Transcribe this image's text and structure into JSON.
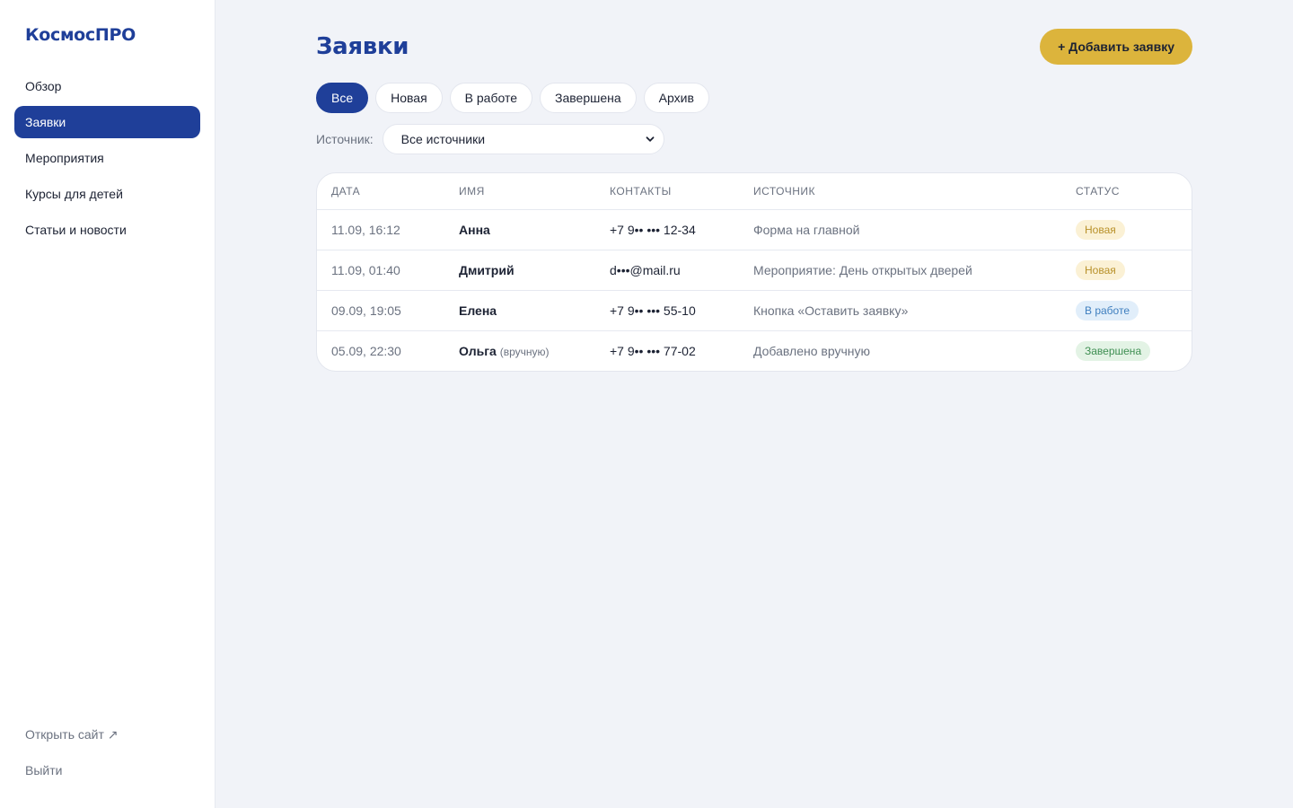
{
  "sidebar": {
    "logo": "КосмосПРО",
    "items": [
      {
        "label": "Обзор"
      },
      {
        "label": "Заявки",
        "active": true
      },
      {
        "label": "Мероприятия"
      },
      {
        "label": "Курсы для детей"
      },
      {
        "label": "Статьи и новости"
      }
    ],
    "open_site": "Открыть сайт ↗",
    "logout": "Выйти"
  },
  "header": {
    "title": "Заявки",
    "add_button": "+ Добавить заявку"
  },
  "filters": {
    "chips": [
      "Все",
      "Новая",
      "В работе",
      "Завершена",
      "Архив"
    ],
    "active": "Все"
  },
  "source_filter": {
    "label": "Источник:",
    "selected": "Все источники"
  },
  "table": {
    "headers": [
      "ДАТА",
      "ИМЯ",
      "КОНТАКТЫ",
      "ИСТОЧНИК",
      "СТАТУС"
    ],
    "rows": [
      {
        "date": "11.09, 16:12",
        "name": "Анна",
        "note": "",
        "contacts": "+7 9•• ••• 12-34",
        "source": "Форма на главной",
        "status": "Новая",
        "status_kind": "new"
      },
      {
        "date": "11.09, 01:40",
        "name": "Дмитрий",
        "note": "",
        "contacts": "d•••@mail.ru",
        "source": "Мероприятие: День открытых дверей",
        "status": "Новая",
        "status_kind": "new"
      },
      {
        "date": "09.09, 19:05",
        "name": "Елена",
        "note": "",
        "contacts": "+7 9•• ••• 55-10",
        "source": "Кнопка «Оставить заявку»",
        "status": "В работе",
        "status_kind": "work"
      },
      {
        "date": "05.09, 22:30",
        "name": "Ольга",
        "note": "(вручную)",
        "contacts": "+7 9•• ••• 77-02",
        "source": "Добавлено вручную",
        "status": "Завершена",
        "status_kind": "done"
      }
    ]
  },
  "colors": {
    "brand": "#1f3f99",
    "accent": "#dcb43c",
    "background": "#f1f3f8"
  }
}
